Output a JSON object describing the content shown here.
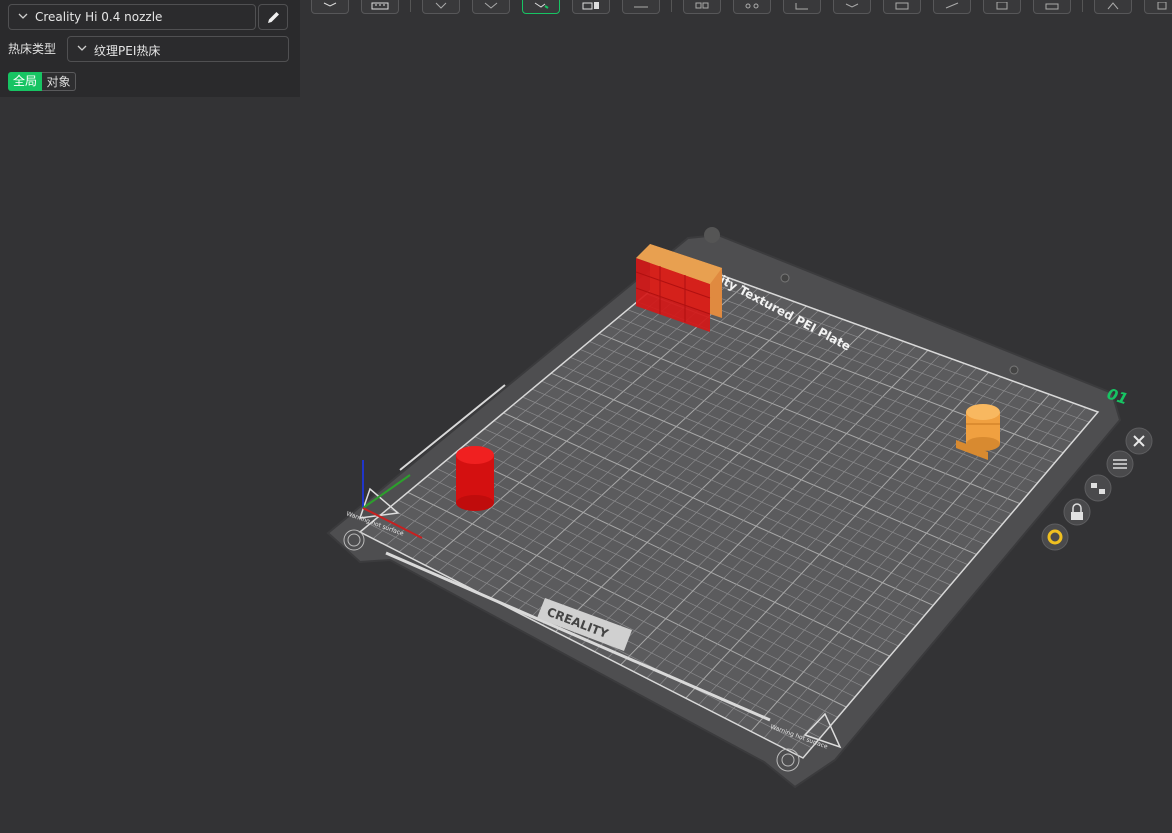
{
  "printer": {
    "name": "Creality Hi 0.4 nozzle"
  },
  "bed": {
    "label": "热床类型",
    "value": "纹理PEI热床"
  },
  "scope_tabs": [
    {
      "label": "全局",
      "active": true
    },
    {
      "label": "对象",
      "active": false
    }
  ],
  "toolbar": {
    "buttons": [
      "add-object",
      "grid-layout",
      "orient",
      "lay-on-face",
      "auto-arrange",
      "split",
      "support-paint",
      "cut",
      "hollow",
      "measure",
      "boolean",
      "scale",
      "seam-paint",
      "text-emboss",
      "assembly",
      "more"
    ],
    "active": "auto-arrange"
  },
  "plate": {
    "number": "01",
    "title_text": "Creality Textured PEI Plate",
    "brand": "CREALITY",
    "warning_text": "Warning hot surface",
    "side_buttons": [
      "close-plate",
      "plate-settings",
      "arrange-plate",
      "lock-plate",
      "plate-gear"
    ]
  },
  "colors": {
    "accent": "#17c463",
    "plate_number": "#17c463",
    "object_red": "#d01414",
    "object_orange": "#f0a040"
  }
}
